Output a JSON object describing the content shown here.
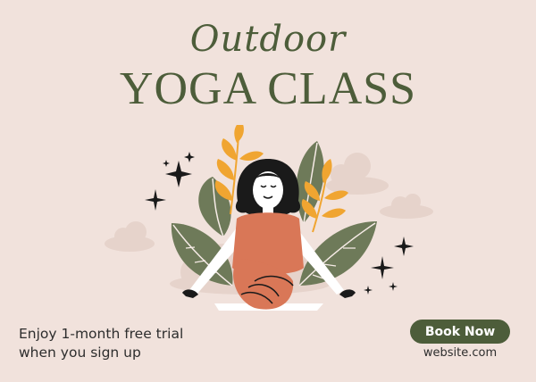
{
  "header": {
    "script_title": "Outdoor",
    "main_title": "YOGA CLASS"
  },
  "promo": {
    "line1": "Enjoy 1-month free trial",
    "line2": "when you sign up"
  },
  "cta": {
    "button_label": "Book Now",
    "website": "website.com"
  },
  "colors": {
    "background": "#f1e2dc",
    "accent_green": "#4d5d3a",
    "leaf_green": "#6e7a59",
    "leaf_orange": "#f0a531",
    "body_terracotta": "#d97757",
    "hair": "#1a1a1a",
    "cloud": "#e6d3cb"
  },
  "icons": [
    "sparkle-icon",
    "cloud-icon",
    "leaf-icon"
  ]
}
